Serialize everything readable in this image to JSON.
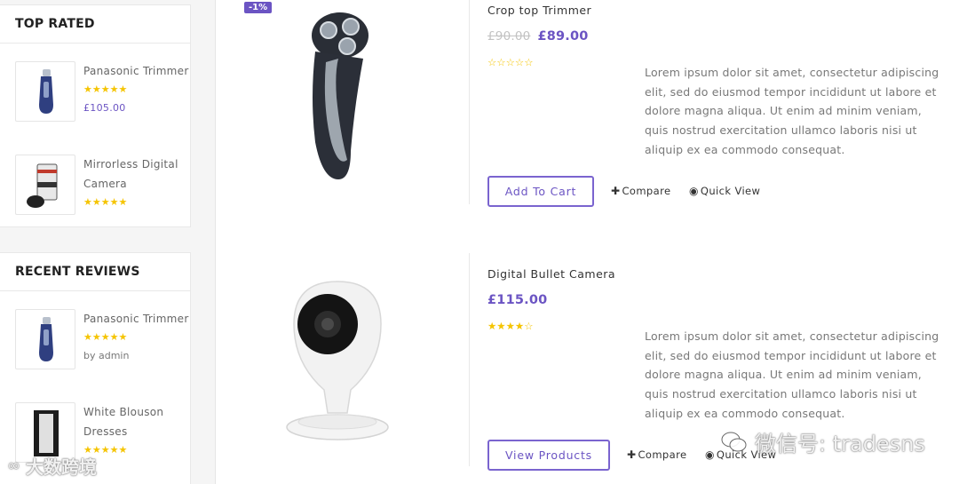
{
  "sidebar": {
    "top_rated": {
      "title": "TOP RATED",
      "items": [
        {
          "name": "Panasonic Trimmer",
          "stars": "★★★★★",
          "price": "£105.00"
        },
        {
          "name": "Mirrorless Digital Camera",
          "stars": "★★★★★"
        }
      ]
    },
    "recent_reviews": {
      "title": "RECENT REVIEWS",
      "items": [
        {
          "name": "Panasonic Trimmer",
          "stars": "★★★★★",
          "by": "by admin"
        },
        {
          "name": "White Blouson Dresses",
          "stars": "★★★★★"
        }
      ]
    }
  },
  "products": [
    {
      "badge": "-1%",
      "title": "Crop top Trimmer",
      "old_price": "£90.00",
      "price": "£89.00",
      "stars": "☆☆☆☆☆",
      "description": "Lorem ipsum dolor sit amet, consectetur adipiscing elit, sed do eiusmod tempor incididunt ut labore et dolore magna aliqua. Ut enim ad minim veniam, quis nostrud exercitation ullamco laboris nisi ut aliquip ex ea commodo consequat.",
      "button": "Add To Cart",
      "compare": "Compare",
      "quick_view": "Quick View"
    },
    {
      "title": "Digital Bullet Camera",
      "price": "£115.00",
      "stars": "★★★★☆",
      "description": "Lorem ipsum dolor sit amet, consectetur adipiscing elit, sed do eiusmod tempor incididunt ut labore et dolore magna aliqua. Ut enim ad minim veniam, quis nostrud exercitation ullamco laboris nisi ut aliquip ex ea commodo consequat.",
      "button": "View Products",
      "compare": "Compare",
      "quick_view": "Quick View"
    }
  ],
  "watermarks": {
    "wechat": "微信号: tradesns",
    "site": "大数跨境"
  },
  "colors": {
    "accent": "#6b54c3",
    "star": "#f5c400"
  },
  "icons": {
    "compare": "plus-icon",
    "quick_view": "eye-icon",
    "wechat": "wechat-icon"
  }
}
